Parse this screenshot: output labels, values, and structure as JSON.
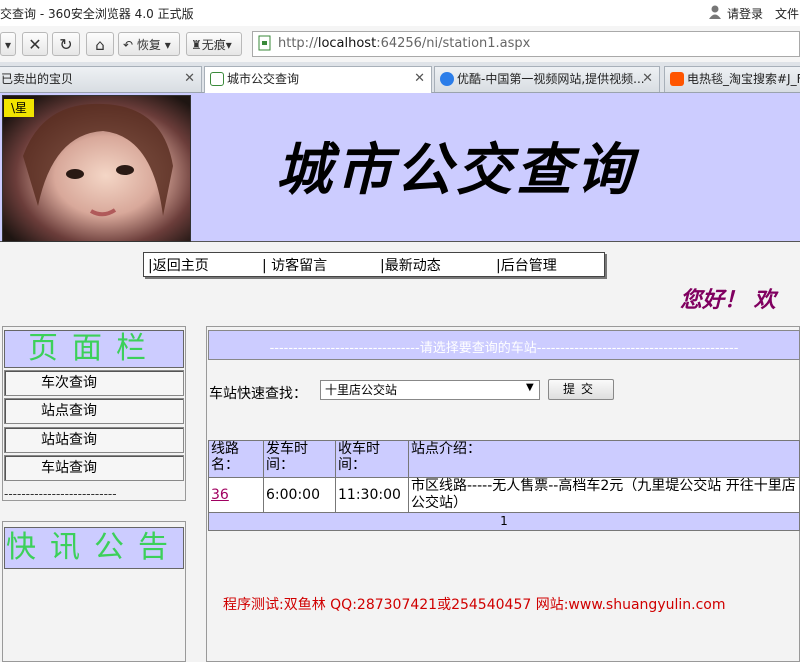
{
  "browser": {
    "title": "交查询 - 360安全浏览器 4.0 正式版",
    "login": "请登录",
    "file_menu": "文件",
    "toolbar": {
      "restore": "恢复",
      "incognito": "无痕"
    },
    "url": {
      "prefix": "http://",
      "host": "localhost",
      "rest": ":64256/ni/station1.aspx"
    },
    "tabs": [
      {
        "label": "已卖出的宝贝"
      },
      {
        "label": "城市公交查询"
      },
      {
        "label": "优酷-中国第一视频网站,提供视频..."
      },
      {
        "label": "电热毯_淘宝搜索#J_Filt"
      }
    ]
  },
  "page": {
    "badge": "\\星",
    "title": "城市公交查询",
    "nav": [
      "|返回主页",
      "| 访客留言",
      "|最新动态",
      "|后台管理"
    ],
    "greeting": "您好！ 欢",
    "sidebar": {
      "heading": "页面栏",
      "items": [
        "车次查询",
        "站点查询",
        "站站查询",
        "车站查询"
      ],
      "divider": "--------------------------",
      "notice_heading": "快讯公告"
    },
    "panel": {
      "title": "--------------------------------请选择要查询的车站-------------------------------------------",
      "search_label": "车站快速查找：",
      "selected_station": "十里店公交站",
      "submit": "提交"
    },
    "table": {
      "headers": [
        "线路名：",
        "发车时间：",
        "收车时间：",
        "站点介绍："
      ],
      "rows": [
        {
          "line": "36",
          "depart": "6:00:00",
          "arrive": "11:30:00",
          "intro": "市区线路-----无人售票--高档车2元（九里堤公交站 开往十里店公交站）"
        }
      ],
      "page_number": "1"
    },
    "credit": "程序测试:双鱼林 QQ:287307421或254540457 网站:www.shuangyulin.com"
  }
}
